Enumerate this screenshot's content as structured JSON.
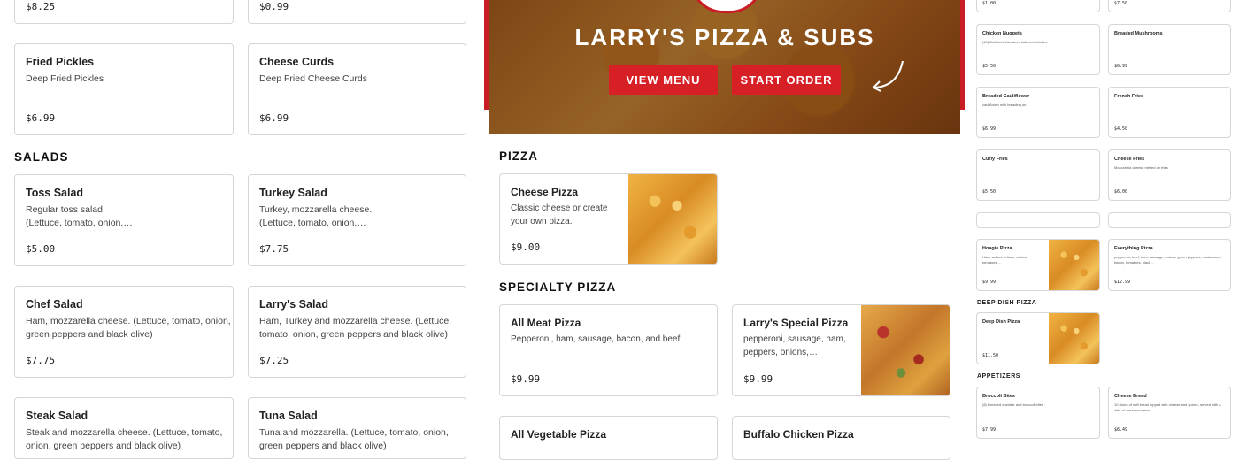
{
  "left": {
    "top_prices": [
      "$8.25",
      "$0.99"
    ],
    "row1": [
      {
        "name": "Fried Pickles",
        "desc": "Deep Fried Pickles",
        "price": "$6.99"
      },
      {
        "name": "Cheese Curds",
        "desc": "Deep Fried Cheese Curds",
        "price": "$6.99"
      }
    ],
    "salads_heading": "SALADS",
    "salads": [
      {
        "name": "Toss Salad",
        "desc": "Regular toss salad.",
        "desc2": "(Lettuce, tomato, onion,…",
        "price": "$5.00"
      },
      {
        "name": "Turkey Salad",
        "desc": "Turkey, mozzarella cheese.",
        "desc2": "(Lettuce, tomato, onion,…",
        "price": "$7.75"
      },
      {
        "name": "Chef Salad",
        "desc": "Ham, mozzarella cheese. (Lettuce, tomato, onion,",
        "desc2": "green peppers and black olive)",
        "price": "$7.75"
      },
      {
        "name": "Larry's Salad",
        "desc": "Ham, Turkey and mozzarella cheese. (Lettuce,",
        "desc2": "tomato, onion, green peppers and black olive)",
        "price": "$7.25"
      },
      {
        "name": "Steak Salad",
        "desc": "Steak and mozzarella cheese. (Lettuce, tomato,",
        "desc2": "onion, green peppers and black olive)"
      },
      {
        "name": "Tuna Salad",
        "desc": "Tuna and mozzarella. (Lettuce, tomato, onion,",
        "desc2": "green peppers and black olive)"
      }
    ]
  },
  "hero": {
    "title": "LARRY'S PIZZA & SUBS",
    "view_menu": "VIEW MENU",
    "start_order": "START ORDER"
  },
  "middle": {
    "pizza_heading": "PIZZA",
    "cheese_pizza": {
      "name": "Cheese Pizza",
      "desc": "Classic cheese or create",
      "desc2": "your own pizza.",
      "price": "$9.00"
    },
    "specialty_heading": "SPECIALTY PIZZA",
    "all_meat": {
      "name": "All Meat Pizza",
      "desc": "Pepperoni, ham, sausage, bacon, and beef.",
      "price": "$9.99"
    },
    "larrys_special": {
      "name": "Larry's Special Pizza",
      "desc": "pepperoni, sausage, ham,",
      "desc2": "peppers, onions,…",
      "price": "$9.99"
    },
    "all_veg": {
      "name": "All Vegetable Pizza"
    },
    "buffalo": {
      "name": "Buffalo Chicken Pizza"
    }
  },
  "right": {
    "top_prices": [
      "$1.00",
      "$7.50"
    ],
    "items": [
      {
        "name": "Chicken Nuggets",
        "desc": "(10) Delicious bite-sized battered chicken.",
        "price": "$5.50"
      },
      {
        "name": "Breaded Mushrooms",
        "desc": "",
        "price": "$6.99"
      },
      {
        "name": "Breaded Cauliflower",
        "desc": "cauliflower with breading on.",
        "price": "$6.99"
      },
      {
        "name": "French Fries",
        "desc": "",
        "price": "$4.50"
      },
      {
        "name": "Curly Fries",
        "desc": "",
        "price": "$5.50"
      },
      {
        "name": "Cheese Fries",
        "desc": "Mozzarella cheese melted on fries",
        "price": "$6.00"
      }
    ],
    "hoagie": {
      "name": "Hoagie Pizza",
      "desc": "Ham, salami, lettuce, onions, tomatoes,…",
      "price": "$9.99"
    },
    "everything": {
      "name": "Everything Pizza",
      "desc": "pepperoni, beef, ham, sausage, onions, green peppers, mushrooms, bacon, tomatoes, black…",
      "price": "$12.99"
    },
    "deep_dish_heading": "DEEP DISH PIZZA",
    "deep_dish": {
      "name": "Deep Dish Pizza",
      "price": "$11.50"
    },
    "appetizers_heading": "APPETIZERS",
    "broccoli": {
      "name": "Broccoli Bites",
      "desc": "(8) Breaded cheddar and broccoli bites",
      "price": "$7.99"
    },
    "cheese_bread": {
      "name": "Cheese Bread",
      "desc": "10 slices of soft bread topped with cheese and spices, served with a side of marinara sauce.",
      "price": "$6.49"
    }
  },
  "colors": {
    "brand_red": "#c81d25",
    "button_red": "#d71f26"
  }
}
